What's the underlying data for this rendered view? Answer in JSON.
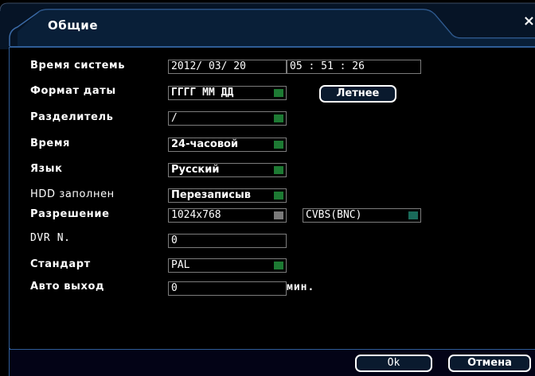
{
  "window": {
    "title": "Общие",
    "close_symbol": "×"
  },
  "rows": {
    "system_time": {
      "label": "Время системь",
      "date": "2012/ 03/ 20",
      "time": "05 : 51 : 26"
    },
    "date_format": {
      "label": "Формат даты",
      "value": "ГГГГ ММ ДД",
      "dst_button": "Летнее"
    },
    "separator": {
      "label": "Разделитель",
      "value": "/"
    },
    "time_format": {
      "label": "Время",
      "value": "24-часовой"
    },
    "language": {
      "label": "Язык",
      "value": "Русский"
    },
    "hdd_full": {
      "label": "HDD заполнен",
      "value": "Перезаписыв"
    },
    "resolution": {
      "label": "Разрешение",
      "value": "1024x768",
      "output": "CVBS(BNC)"
    },
    "dvr_no": {
      "label": "DVR N.",
      "value": "0"
    },
    "video_standard": {
      "label": "Стандарт",
      "value": "PAL"
    },
    "auto_logout": {
      "label": "Авто выход",
      "value": "0",
      "unit": "мин."
    }
  },
  "buttons": {
    "ok": "Ok",
    "cancel": "Отмена"
  },
  "colors": {
    "frame_blue": "#2f5d97",
    "dropdown_green": "#1d7a33",
    "background": "#000000"
  }
}
